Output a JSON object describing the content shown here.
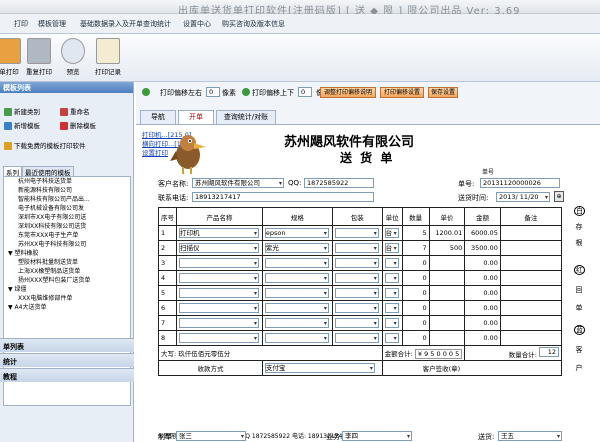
{
  "window": {
    "title": "出库单送货单打印软件[注册码版] [ 送 ◆ 限 ] 限公司出品  Ver: 3.69"
  },
  "menu": [
    "打印",
    "模板管理",
    "基础数据录入及开单查询统计",
    "设置中心",
    "购买咨询及版本信息"
  ],
  "toolbar": [
    "单打印",
    "重复打印",
    "预览",
    "打印记录"
  ],
  "sidebar": {
    "header": "模板列表",
    "buttons": [
      "新建类别",
      "重命名",
      "新增模板",
      "删除模板",
      "下载免费的模板打印软件"
    ],
    "tree_tabs": [
      "系列",
      "最近使用的模板"
    ],
    "tree": [
      "杭州电子科技送货单",
      "新能源科技有限公司",
      "智能科技有限公司产品出...",
      "电子机械设备有限公司发",
      "深圳市XX电子有限公司送",
      "深圳XX科技有限公司送货",
      "东莞市XXX电子生产单",
      "苏州XX电子科技有限公司",
      "▼ 塑料橡胶",
      "塑胶材料批量制送货单",
      "上海XX橡塑制品送货单",
      "扬州XXX塑料包装厂送货单",
      "▼ 绿僵",
      "XXX电脑维修部件单",
      "▼ A4大送货单"
    ],
    "footer": [
      "单列表",
      "统计",
      "教程"
    ]
  },
  "controls": {
    "h_offset_label": "打印偏移左右",
    "h_offset": "0",
    "px1": "像素",
    "v_offset_label": "打印偏移上下",
    "v_offset": "0",
    "px2": "像素",
    "btn1": "调整打印偏移说明",
    "btn2": "打印偏移设置",
    "btn3": "保存设置"
  },
  "tabs": [
    "导航",
    "开单",
    "查询统计/对账"
  ],
  "links": [
    "打印机...[215.0]",
    "横向打印...[137]",
    "设置打印"
  ],
  "doc": {
    "company": "苏州飓风软件有限公司",
    "title": "送 货 单",
    "no_caption": "单号",
    "customer_label": "客户名称:",
    "customer": "苏州飓风软件有限公司",
    "qq_label": "QQ:",
    "qq": "1872585922",
    "order_no_label": "单号:",
    "order_no": "20131120000026",
    "phone_label": "联系电话:",
    "phone": "18913217417",
    "date_label": "送货时间:",
    "date": "2013/ 11/20"
  },
  "table": {
    "headers": [
      "序号",
      "产品名称",
      "规格",
      "包装",
      "单位",
      "数量",
      "单价",
      "金额",
      "备注"
    ],
    "rows": [
      {
        "no": "1",
        "name": "打印机",
        "spec": "epson",
        "pack": "",
        "unit": "台",
        "qty": "5",
        "price": "1200.01",
        "amount": "6000.05",
        "note": ""
      },
      {
        "no": "2",
        "name": "扫描仪",
        "spec": "紫光",
        "pack": "",
        "unit": "台",
        "qty": "7",
        "price": "500",
        "amount": "3500.00",
        "note": ""
      },
      {
        "no": "3",
        "name": "",
        "spec": "",
        "pack": "",
        "unit": "",
        "qty": "0",
        "price": "",
        "amount": "0.00",
        "note": ""
      },
      {
        "no": "4",
        "name": "",
        "spec": "",
        "pack": "",
        "unit": "",
        "qty": "0",
        "price": "",
        "amount": "0.00",
        "note": ""
      },
      {
        "no": "5",
        "name": "",
        "spec": "",
        "pack": "",
        "unit": "",
        "qty": "0",
        "price": "",
        "amount": "0.00",
        "note": ""
      },
      {
        "no": "6",
        "name": "",
        "spec": "",
        "pack": "",
        "unit": "",
        "qty": "0",
        "price": "",
        "amount": "0.00",
        "note": ""
      },
      {
        "no": "7",
        "name": "",
        "spec": "",
        "pack": "",
        "unit": "",
        "qty": "0",
        "price": "",
        "amount": "0.00",
        "note": ""
      },
      {
        "no": "8",
        "name": "",
        "spec": "",
        "pack": "",
        "unit": "",
        "qty": "0",
        "price": "",
        "amount": "0.00",
        "note": ""
      }
    ],
    "total_caps_label": "大写: 玖仟伍佰元零伍分",
    "total_label": "金额合计:",
    "total": "¥ 9 5 0 0 0 5",
    "qty_total_label": "数量合计:",
    "qty_total": "12",
    "payment_label": "收款方式",
    "payment": "支付宝",
    "sign_label": "客户签收(章)"
  },
  "footer": {
    "contact": "公司网址: www.fastmis.com   QQ 1872585922  电话: 18913217417  联系:",
    "maker_label": "制单:",
    "maker": "张三",
    "sales_label": "业务:",
    "sales": "李四",
    "deliver_label": "送货:",
    "deliver": "王五"
  },
  "side_copy": [
    "白",
    "存",
    "根",
    "红",
    "回",
    "单",
    "蓝",
    "客",
    "户"
  ]
}
